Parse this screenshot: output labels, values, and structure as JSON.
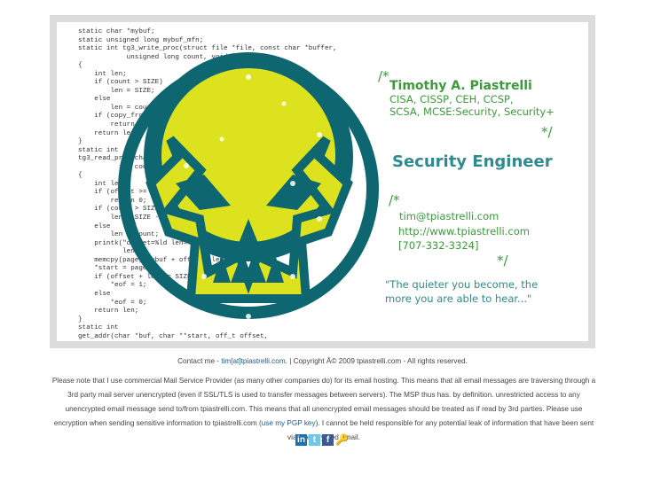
{
  "banner": {
    "code_lines": [
      "static char *mybuf;",
      "static unsigned long mybuf_mfn;",
      "static int tg3_write_proc(struct file *file, const char *buffer,",
      "            unsigned long count, void *data)",
      "{",
      "    int len;",
      "    if (count > SIZE)",
      "        len = SIZE;",
      "    else",
      "        len = count;",
      "    if (copy_from_user(mybuf, buffer, len))",
      "        return -EFAULT;",
      "    return len;",
      "}",
      "static int",
      "tg3_read_proc(char *page, char **start, off_t offset,",
      "          int count, int *eof, void *data)",
      "{",
      "    int len;",
      "    if (offset >= SIZE)",
      "        return 0;",
      "    if (count > SIZE - offset)",
      "        len = SIZE - offset;",
      "    else",
      "        len = count;",
      "    printk(\"offset=%ld len=%d\\n\", offset,",
      "           len);",
      "    memcpy(page, mybuf + offset, len);",
      "    *start = page;",
      "    if (offset + len >= SIZE)",
      "        *eof = 1;",
      "    else",
      "        *eof = 0;",
      "    return len;",
      "}",
      "static int",
      "get_addr(char *buf, char **start, off_t offset,"
    ],
    "comment_open": "/*",
    "comment_close": "*/",
    "name": "Timothy A. Piastrelli",
    "certs_line1": "CISA, CISSP, CEH, CCSP,",
    "certs_line2": "SCSA, MCSE:Security, Security+",
    "title": "Security Engineer",
    "email": "tim@tpiastrelli.com",
    "website": "http://www.tpiastrelli.com",
    "phone": "[707-332-3324]",
    "quote_line1": "\"The quieter you become, the",
    "quote_line2": "more you are able to hear...\""
  },
  "footer": {
    "contact_prefix": "Contact me - ",
    "contact_link": "tim[at]tpiastrelli.com",
    "contact_suffix": ". | Copyright Â© 2009 tpiastrelli.com - All rights reserved.",
    "notice_1": "Please note that I use commercial Mail Service Provider (as many other companies do) for its email hosting. This means that all email messages are traversing through a 3rd party mail server unencrypted (even if SSL/TLS is used to transfer messages between servers). The MSP thus has. by definition. unrestricted access to any unencrypted email message send to/from tpiastrelli.com. This means that all unencrypted email messages should be treated as if read by 3rd parties. Please use encryption when sending sensitive information to tpiastrelli.com (",
    "pgp_link": "use my PGP key",
    "notice_2": "). I cannot be held responsible for any potential leak of information that have been sent via unencrypted email.",
    "social": {
      "linkedin": "in",
      "twitter": "t",
      "facebook": "f"
    }
  },
  "colors": {
    "teal": "#0e6670",
    "yellow": "#dde21f",
    "green": "#3c9a3c",
    "frame": "#dcdcdc"
  }
}
